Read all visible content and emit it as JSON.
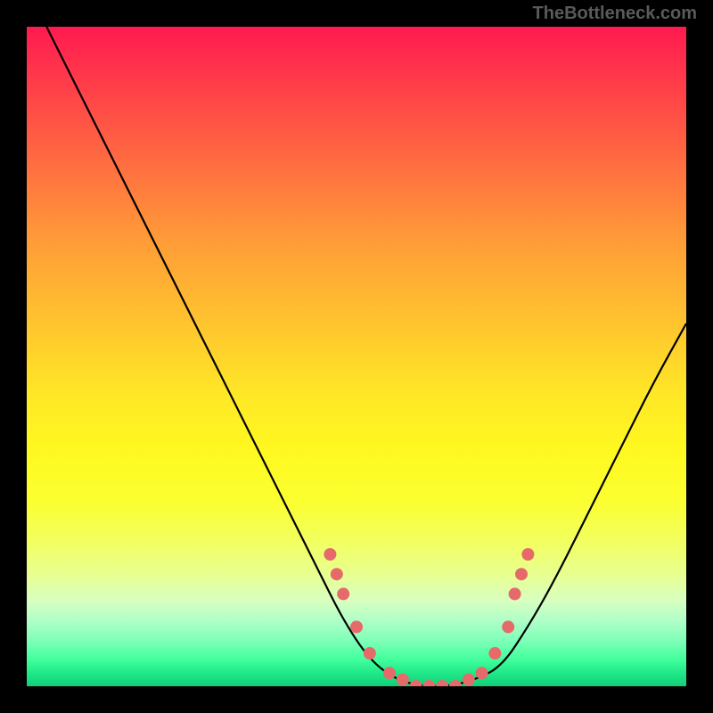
{
  "watermark": "TheBottleneck.com",
  "chart_data": {
    "type": "line",
    "title": "",
    "xlabel": "",
    "ylabel": "",
    "xlim": [
      0,
      100
    ],
    "ylim": [
      0,
      100
    ],
    "gradient_stops": [
      {
        "pct": 0,
        "color": "#ff1a50"
      },
      {
        "pct": 50,
        "color": "#ffe826"
      },
      {
        "pct": 80,
        "color": "#f2ff60"
      },
      {
        "pct": 95,
        "color": "#40ff9c"
      },
      {
        "pct": 100,
        "color": "#10d078"
      }
    ],
    "series": [
      {
        "name": "bottleneck-curve",
        "color": "#000000",
        "points": [
          {
            "x": 3,
            "y": 100
          },
          {
            "x": 8,
            "y": 90
          },
          {
            "x": 14,
            "y": 78
          },
          {
            "x": 20,
            "y": 66
          },
          {
            "x": 26,
            "y": 54
          },
          {
            "x": 32,
            "y": 42
          },
          {
            "x": 38,
            "y": 30
          },
          {
            "x": 44,
            "y": 18
          },
          {
            "x": 48,
            "y": 10
          },
          {
            "x": 52,
            "y": 4
          },
          {
            "x": 56,
            "y": 1
          },
          {
            "x": 60,
            "y": 0
          },
          {
            "x": 64,
            "y": 0
          },
          {
            "x": 68,
            "y": 1
          },
          {
            "x": 72,
            "y": 3
          },
          {
            "x": 76,
            "y": 9
          },
          {
            "x": 80,
            "y": 16
          },
          {
            "x": 85,
            "y": 26
          },
          {
            "x": 90,
            "y": 36
          },
          {
            "x": 95,
            "y": 46
          },
          {
            "x": 100,
            "y": 55
          }
        ]
      }
    ],
    "markers": {
      "name": "data-points",
      "color": "#e76a6a",
      "radius": 7,
      "points": [
        {
          "x": 46,
          "y": 20
        },
        {
          "x": 47,
          "y": 17
        },
        {
          "x": 48,
          "y": 14
        },
        {
          "x": 50,
          "y": 9
        },
        {
          "x": 52,
          "y": 5
        },
        {
          "x": 55,
          "y": 2
        },
        {
          "x": 57,
          "y": 1
        },
        {
          "x": 59,
          "y": 0
        },
        {
          "x": 61,
          "y": 0
        },
        {
          "x": 63,
          "y": 0
        },
        {
          "x": 65,
          "y": 0
        },
        {
          "x": 67,
          "y": 1
        },
        {
          "x": 69,
          "y": 2
        },
        {
          "x": 71,
          "y": 5
        },
        {
          "x": 73,
          "y": 9
        },
        {
          "x": 74,
          "y": 14
        },
        {
          "x": 75,
          "y": 17
        },
        {
          "x": 76,
          "y": 20
        }
      ]
    }
  }
}
